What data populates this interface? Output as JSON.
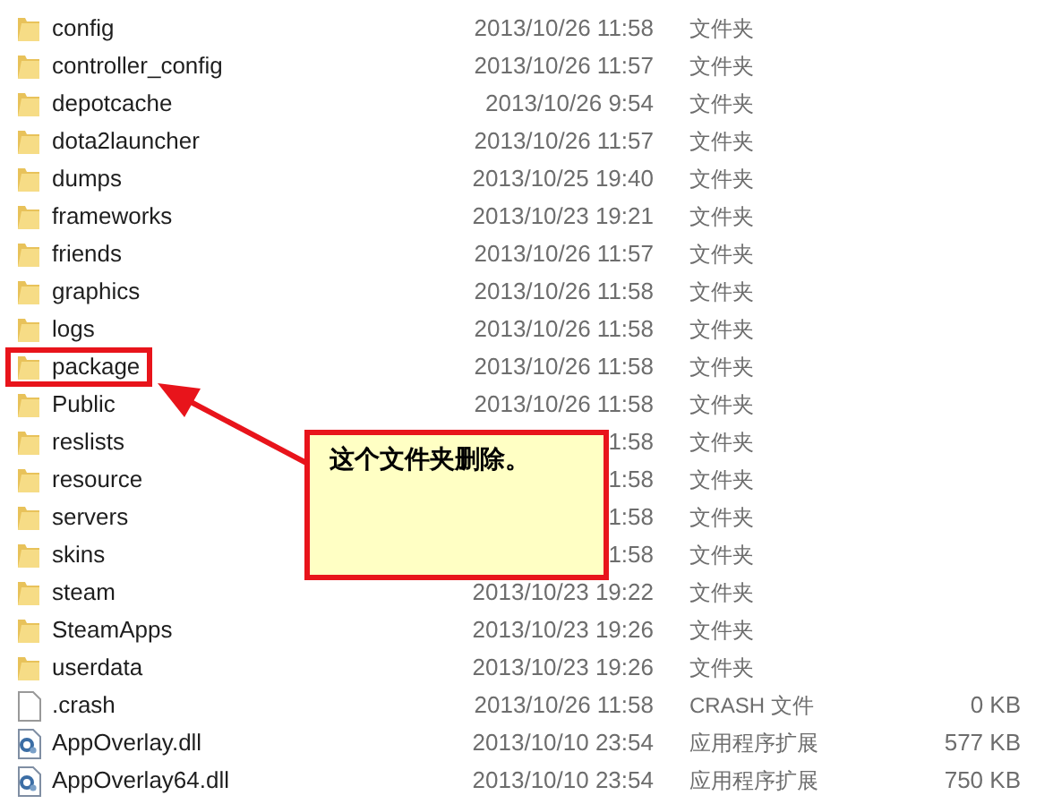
{
  "files": [
    {
      "kind": "folder",
      "name": "config",
      "date": "2013/10/26 11:58",
      "type": "文件夹",
      "highlighted": false
    },
    {
      "kind": "folder",
      "name": "controller_config",
      "date": "2013/10/26 11:57",
      "type": "文件夹",
      "highlighted": false
    },
    {
      "kind": "folder",
      "name": "depotcache",
      "date": "2013/10/26 9:54",
      "type": "文件夹",
      "highlighted": false
    },
    {
      "kind": "folder",
      "name": "dota2launcher",
      "date": "2013/10/26 11:57",
      "type": "文件夹",
      "highlighted": false
    },
    {
      "kind": "folder",
      "name": "dumps",
      "date": "2013/10/25 19:40",
      "type": "文件夹",
      "highlighted": false
    },
    {
      "kind": "folder",
      "name": "frameworks",
      "date": "2013/10/23 19:21",
      "type": "文件夹",
      "highlighted": false
    },
    {
      "kind": "folder",
      "name": "friends",
      "date": "2013/10/26 11:57",
      "type": "文件夹",
      "highlighted": false
    },
    {
      "kind": "folder",
      "name": "graphics",
      "date": "2013/10/26 11:58",
      "type": "文件夹",
      "highlighted": false
    },
    {
      "kind": "folder",
      "name": "logs",
      "date": "2013/10/26 11:58",
      "type": "文件夹",
      "highlighted": false
    },
    {
      "kind": "folder",
      "name": "package",
      "date": "2013/10/26 11:58",
      "type": "文件夹",
      "highlighted": true
    },
    {
      "kind": "folder",
      "name": "Public",
      "date": "2013/10/26 11:58",
      "type": "文件夹",
      "highlighted": false
    },
    {
      "kind": "folder",
      "name": "reslists",
      "date": "1:58",
      "type": "文件夹",
      "highlighted": false
    },
    {
      "kind": "folder",
      "name": "resource",
      "date": "1:58",
      "type": "文件夹",
      "highlighted": false
    },
    {
      "kind": "folder",
      "name": "servers",
      "date": "1:58",
      "type": "文件夹",
      "highlighted": false
    },
    {
      "kind": "folder",
      "name": "skins",
      "date": "1:58",
      "type": "文件夹",
      "highlighted": false
    },
    {
      "kind": "folder",
      "name": "steam",
      "date": "2013/10/23 19:22",
      "type": "文件夹",
      "highlighted": false
    },
    {
      "kind": "folder",
      "name": "SteamApps",
      "date": "2013/10/23 19:26",
      "type": "文件夹",
      "highlighted": false
    },
    {
      "kind": "folder",
      "name": "userdata",
      "date": "2013/10/23 19:26",
      "type": "文件夹",
      "highlighted": false
    },
    {
      "kind": "file",
      "name": ".crash",
      "date": "2013/10/26 11:58",
      "type": "CRASH 文件",
      "size": "0 KB",
      "highlighted": false
    },
    {
      "kind": "dll",
      "name": "AppOverlay.dll",
      "date": "2013/10/10 23:54",
      "type": "应用程序扩展",
      "size": "577 KB",
      "highlighted": false
    },
    {
      "kind": "dll",
      "name": "AppOverlay64.dll",
      "date": "2013/10/10 23:54",
      "type": "应用程序扩展",
      "size": "750 KB",
      "highlighted": false
    }
  ],
  "callout": {
    "text": "这个文件夹删除。"
  }
}
